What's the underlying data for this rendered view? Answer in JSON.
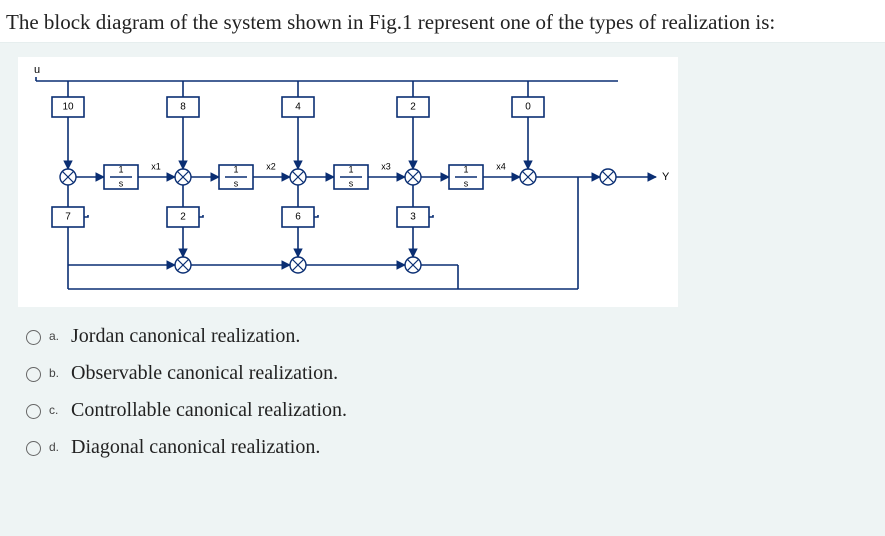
{
  "question": "The block diagram of the system shown in Fig.1 represent one of the types of realization is:",
  "diagram": {
    "input_label": "u",
    "output_label": "Y",
    "top_gains": [
      "10",
      "8",
      "4",
      "2",
      "0"
    ],
    "bottom_gains": [
      "7",
      "2",
      "6",
      "3"
    ],
    "integrator_label": "1/s",
    "state_labels": [
      "x1",
      "x2",
      "x3",
      "x4"
    ]
  },
  "options": [
    {
      "letter": "a.",
      "text": "Jordan canonical realization."
    },
    {
      "letter": "b.",
      "text": "Observable canonical realization."
    },
    {
      "letter": "c.",
      "text": "Controllable canonical realization."
    },
    {
      "letter": "d.",
      "text": "Diagonal canonical realization."
    }
  ]
}
